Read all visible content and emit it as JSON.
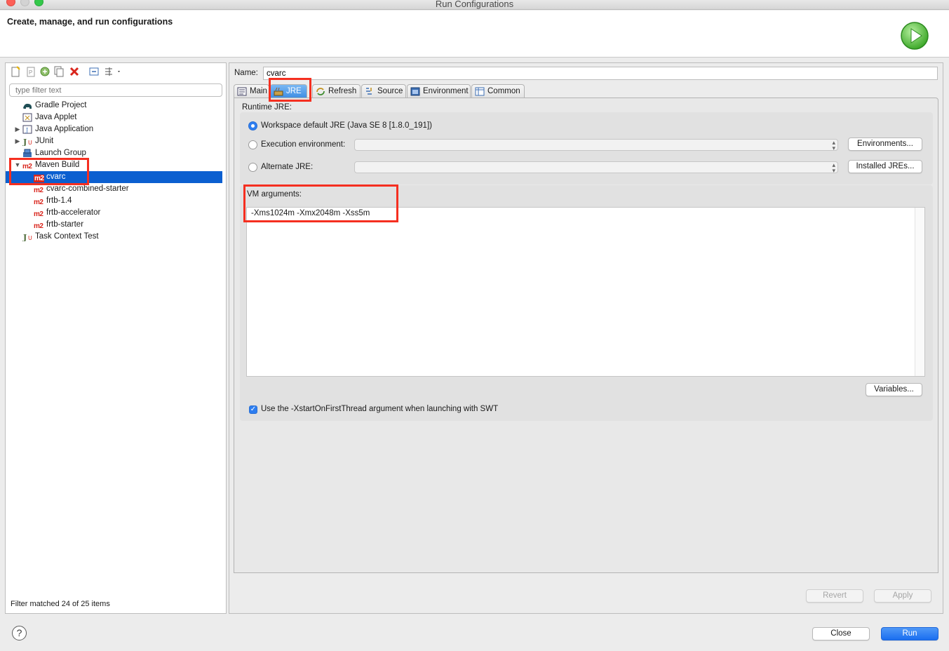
{
  "window": {
    "title": "Run Configurations"
  },
  "header": {
    "title": "Create, manage, and run configurations"
  },
  "left": {
    "filter_placeholder": "type filter text",
    "tree": [
      {
        "label": "Gradle Project",
        "icon": "gradle-icon"
      },
      {
        "label": "Java Applet",
        "icon": "java-applet-icon"
      },
      {
        "label": "Java Application",
        "icon": "java-application-icon",
        "expandable": true
      },
      {
        "label": "JUnit",
        "icon": "junit-icon",
        "expandable": true
      },
      {
        "label": "Launch Group",
        "icon": "launch-group-icon"
      },
      {
        "label": "Maven Build",
        "icon": "maven-icon",
        "expanded": true
      },
      {
        "label": "cvarc",
        "icon": "maven-icon",
        "selected": true
      },
      {
        "label": "cvarc-combined-starter",
        "icon": "maven-icon"
      },
      {
        "label": "frtb-1.4",
        "icon": "maven-icon"
      },
      {
        "label": "frtb-accelerator",
        "icon": "maven-icon"
      },
      {
        "label": "frtb-starter",
        "icon": "maven-icon"
      },
      {
        "label": "Task Context Test",
        "icon": "task-context-test-icon"
      }
    ],
    "m2_badge": "m2",
    "filter_status": "Filter matched 24 of 25 items"
  },
  "right": {
    "name_label": "Name:",
    "name_value": "cvarc",
    "tabs": [
      {
        "label": "Main",
        "icon": "main-tab-icon"
      },
      {
        "label": "JRE",
        "icon": "jre-tab-icon",
        "active": true
      },
      {
        "label": "Refresh",
        "icon": "refresh-tab-icon"
      },
      {
        "label": "Source",
        "icon": "source-tab-icon"
      },
      {
        "label": "Environment",
        "icon": "environment-tab-icon"
      },
      {
        "label": "Common",
        "icon": "common-tab-icon"
      }
    ],
    "jre": {
      "runtime_label": "Runtime JRE:",
      "workspace_default": "Workspace default JRE (Java SE 8 [1.8.0_191])",
      "execution_env": "Execution environment:",
      "alternate_jre": "Alternate JRE:",
      "environments_button": "Environments...",
      "installed_jres_button": "Installed JREs...",
      "selected_option": "workspace_default"
    },
    "vm": {
      "label": "VM arguments:",
      "value": "-Xms1024m -Xmx2048m -Xss5m",
      "variables_button": "Variables..."
    },
    "swt_checkbox": {
      "label": "Use the -XstartOnFirstThread argument when launching with SWT",
      "checked": true
    },
    "revert_button": "Revert",
    "apply_button": "Apply"
  },
  "footer": {
    "close_button": "Close",
    "run_button": "Run",
    "help": "?"
  },
  "colors": {
    "selection": "#0b5fd0",
    "highlight_box": "#f52f20",
    "run_button": "#1a6ef0",
    "maven_red": "#d9251c"
  }
}
